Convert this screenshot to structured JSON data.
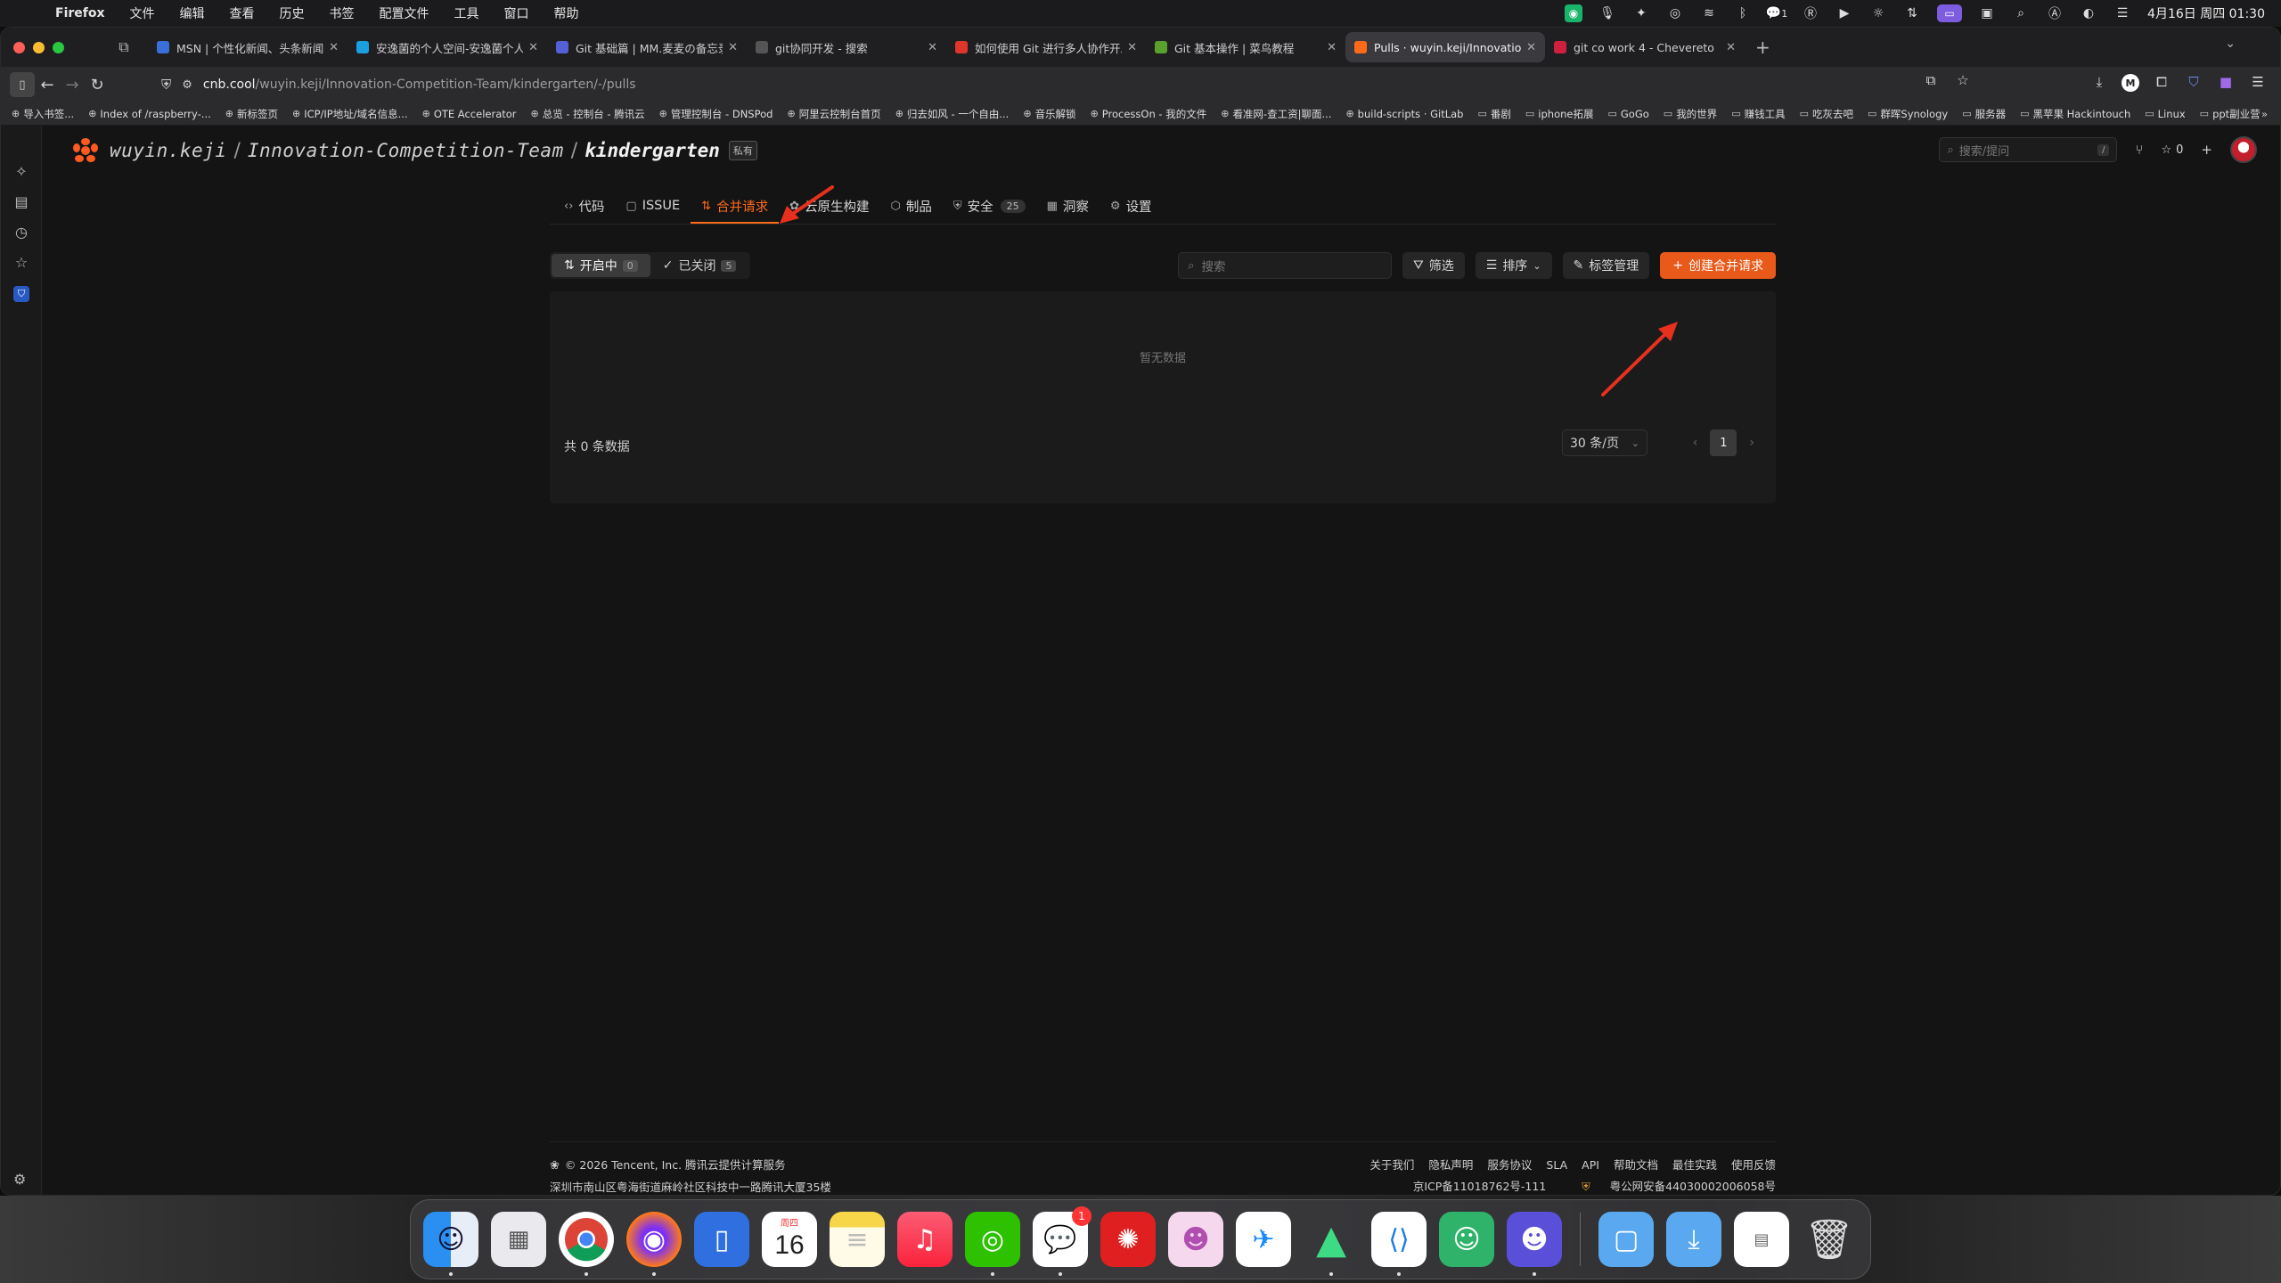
{
  "menubar": {
    "app_name": "Firefox",
    "menus": [
      "文件",
      "编辑",
      "查看",
      "历史",
      "书签",
      "配置文件",
      "工具",
      "窗口",
      "帮助"
    ],
    "clock": "4月16日 周四 01:30",
    "badge_count": "1"
  },
  "tabs": [
    {
      "title": "MSN | 个性化新闻、头条新闻、实",
      "color": "#3b6fd8"
    },
    {
      "title": "安逸菌的个人空间-安逸菌个人主页",
      "color": "#1aa0e0"
    },
    {
      "title": "Git 基础篇 | MM.麦麦の备忘录",
      "color": "#5560d8"
    },
    {
      "title": "git协同开发 - 搜索",
      "color": "#555555"
    },
    {
      "title": "如何使用 Git 进行多人协作开发（",
      "color": "#e0352b"
    },
    {
      "title": "Git 基本操作 | 菜鸟教程",
      "color": "#5aa02c"
    },
    {
      "title": "Pulls · wuyin.keji/Innovation-Co",
      "color": "#ff6a1a",
      "active": true
    },
    {
      "title": "git co work 4 - Chevereto",
      "color": "#d02040"
    }
  ],
  "url": {
    "domain": "cnb.cool",
    "path": "/wuyin.keji/Innovation-Competition-Team/kindergarten/-/pulls"
  },
  "bookmarks": [
    "导入书签...",
    "Index of /raspberry-...",
    "新标签页",
    "ICP/IP地址/域名信息...",
    "OTE Accelerator",
    "总览 - 控制台 - 腾讯云",
    "管理控制台 - DNSPod",
    "阿里云控制台首页",
    "归去如风 - 一个自由...",
    "音乐解锁",
    "ProcessOn - 我的文件",
    "看准网-查工资|聊面...",
    "build-scripts · GitLab",
    "番剧",
    "iphone拓展",
    "GoGo",
    "我的世界",
    "赚钱工具",
    "吃灰去吧",
    "群晖Synology",
    "服务器",
    "黑苹果 Hackintouch",
    "Linux",
    "ppt副业营"
  ],
  "repo": {
    "owner": "wuyin.keji",
    "group": "Innovation-Competition-Team",
    "name": "kindergarten",
    "visibility": "私有"
  },
  "header": {
    "search_placeholder": "搜索/提问",
    "shortcut": "/",
    "star_count": "0"
  },
  "repo_tabs": [
    {
      "label": "代码",
      "icon": "code-icon"
    },
    {
      "label": "ISSUE",
      "icon": "issue-icon"
    },
    {
      "label": "合并请求",
      "icon": "pull-request-icon",
      "active": true
    },
    {
      "label": "云原生构建",
      "icon": "cloud-build-icon"
    },
    {
      "label": "制品",
      "icon": "package-icon"
    },
    {
      "label": "安全",
      "icon": "shield-icon",
      "count": "25"
    },
    {
      "label": "洞察",
      "icon": "insights-icon"
    },
    {
      "label": "设置",
      "icon": "gear-icon"
    }
  ],
  "filters": {
    "open_label": "开启中",
    "open_count": "0",
    "closed_label": "已关闭",
    "closed_count": "5",
    "search_placeholder": "搜索",
    "filter_label": "筛选",
    "sort_label": "排序",
    "labels_label": "标签管理",
    "create_label": "创建合并请求"
  },
  "list": {
    "empty_text": "暂无数据",
    "total_text": "共 0 条数据",
    "page_size": "30 条/页",
    "current_page": "1"
  },
  "footer": {
    "copyright": "© 2026 Tencent, Inc. 腾讯云提供计算服务",
    "address": "深圳市南山区粤海街道麻岭社区科技中一路腾讯大厦35楼",
    "links": [
      "关于我们",
      "隐私声明",
      "服务协议",
      "SLA",
      "API",
      "帮助文档",
      "最佳实践",
      "使用反馈"
    ],
    "icp": "京ICP备11018762号-111",
    "police": "粤公网安备44030002006058号"
  },
  "dock": {
    "calendar_month": "周四",
    "calendar_day": "16",
    "messages_badge": "1"
  },
  "colors": {
    "accent": "#ff6a1a",
    "primary_button": "#e8591a",
    "annotation_arrow": "#e8301e"
  }
}
